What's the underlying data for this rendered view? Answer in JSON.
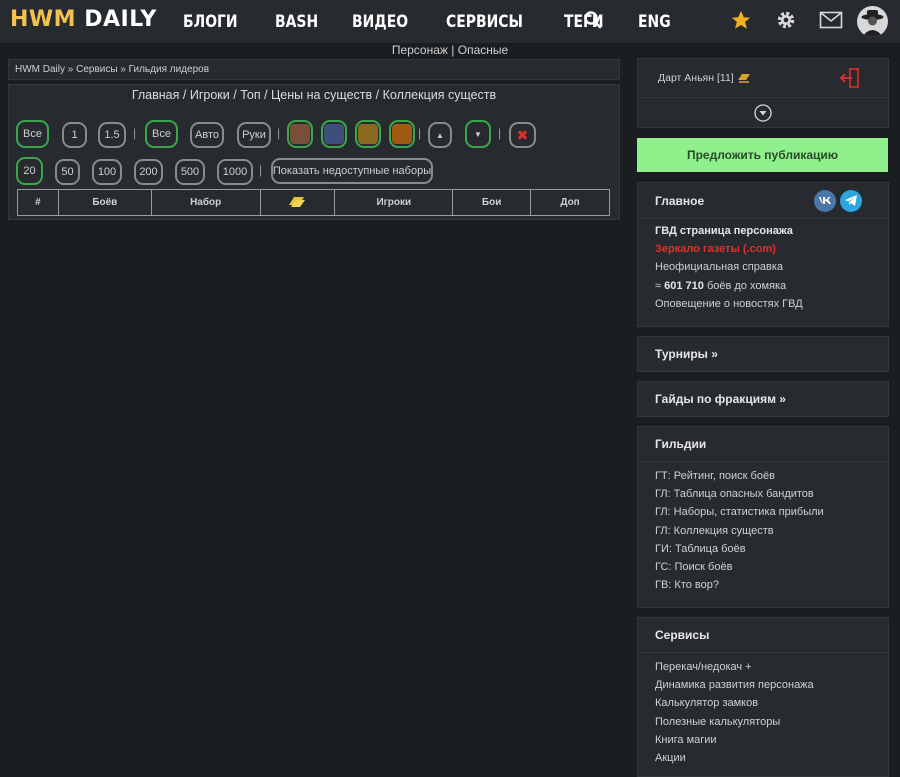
{
  "brand": {
    "part1": "HWM",
    "part2": "DAILY"
  },
  "nav": [
    "БЛОГИ",
    "BASH",
    "ВИДЕО",
    "СЕРВИСЫ",
    "ТЕГИ",
    "ENG"
  ],
  "subnav": {
    "link1": "Персонаж",
    "sep": "|",
    "link2": "Опасные"
  },
  "breadcrumb": "HWM Daily » Сервисы » Гильдия лидеров",
  "main_links": {
    "items": [
      "Главная",
      "Игроки",
      "Топ",
      "Цены на существ",
      "Коллекция существ"
    ],
    "sep": "/"
  },
  "filters": {
    "all_label": "Все",
    "levels": [
      "1",
      "1.5"
    ],
    "all2_label": "Все",
    "modes": [
      "Авто",
      "Руки"
    ],
    "divider": "|",
    "swatch_colors": [
      "#7a4f3a",
      "#3d4f7a",
      "#8a6a20",
      "#a05a12"
    ],
    "sort_up_icon": "▲",
    "sort_down_icon": "▼",
    "reset_icon": "✖",
    "accent_color": "#3aa84a",
    "reset_color": "#e0302a"
  },
  "page_sizes": [
    "20",
    "50",
    "100",
    "200",
    "500",
    "1000"
  ],
  "show_unavailable": "Показать недоступные наборы",
  "table_headers": [
    "#",
    "Боёв",
    "Набор",
    "",
    "Игроки",
    "Бои",
    "Доп"
  ],
  "user": {
    "name": "Дарт Аньян [11]",
    "logout_icon": "logout-icon"
  },
  "publish_button": "Предложить публикацию",
  "main_card": {
    "title": "Главное",
    "social": [
      "VK",
      "Telegram"
    ],
    "items": [
      "ГВД страница персонажа",
      "Зеркало газеты (.com)",
      "Неофициальная справка",
      "Оповещение о новостях ГВД"
    ],
    "battles_prefix": "≈",
    "battles_count": "601 710",
    "battles_suffix": "боёв до хомяка"
  },
  "tournaments": "Турниры »",
  "faction_guides": "Гайды по фракциям »",
  "guilds": {
    "title": "Гильдии",
    "items": [
      "ГТ: Рейтинг, поиск боёв",
      "ГЛ: Таблица опасных бандитов",
      "ГЛ: Наборы, статистика прибыли",
      "ГЛ: Коллекция существ",
      "ГИ: Таблица боёв",
      "ГС: Поиск боёв",
      "ГВ: Кто вор?"
    ]
  },
  "services": {
    "title": "Сервисы",
    "items": [
      "Перекач/недокач +",
      "Динамика развития персонажа",
      "Калькулятор замков",
      "Полезные калькуляторы",
      "Книга магии",
      "Акции"
    ]
  },
  "colors": {
    "highlight_red": "#e0302a",
    "publish_bg": "#8ff08c",
    "gold": "#f2c14e"
  }
}
